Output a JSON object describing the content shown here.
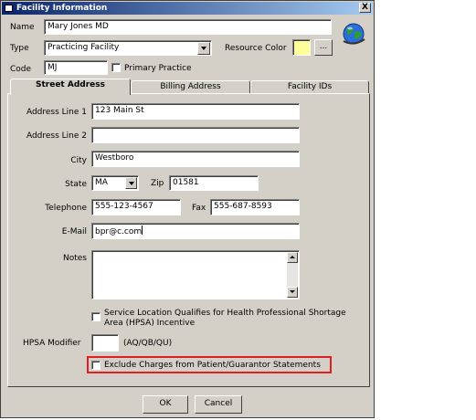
{
  "window": {
    "title": "Facility Information",
    "close_label": "X"
  },
  "header": {
    "name_label": "Name",
    "name_value": "Mary Jones MD",
    "type_label": "Type",
    "type_value": "Practicing Facility",
    "resource_color_label": "Resource Color",
    "resource_color_value": "#ffff99",
    "ellipsis_label": "...",
    "code_label": "Code",
    "code_value": "MJ",
    "primary_practice_label": "Primary Practice",
    "primary_practice_checked": false
  },
  "tabs": [
    {
      "label": "Street Address",
      "active": true
    },
    {
      "label": "Billing Address",
      "active": false
    },
    {
      "label": "Facility IDs",
      "active": false
    }
  ],
  "address": {
    "line1_label": "Address Line 1",
    "line1_value": "123 Main St",
    "line2_label": "Address Line 2",
    "line2_value": "",
    "city_label": "City",
    "city_value": "Westboro",
    "state_label": "State",
    "state_value": "MA",
    "zip_label": "Zip",
    "zip_value": "01581",
    "telephone_label": "Telephone",
    "telephone_value": "555-123-4567",
    "fax_label": "Fax",
    "fax_value": "555-687-8593",
    "email_label": "E-Mail",
    "email_value": "bpr@c.com",
    "notes_label": "Notes",
    "notes_value": "",
    "hpsa_qualifies_label_1": "Service Location Qualifies for Health Professional Shortage",
    "hpsa_qualifies_label_2": "Area (HPSA) Incentive",
    "hpsa_modifier_label": "HPSA Modifier",
    "hpsa_modifier_value": "",
    "hpsa_modifier_hint": "(AQ/QB/QU)",
    "exclude_charges_label": "Exclude Charges from Patient/Guarantor Statements"
  },
  "footer": {
    "ok_label": "OK",
    "cancel_label": "Cancel"
  }
}
